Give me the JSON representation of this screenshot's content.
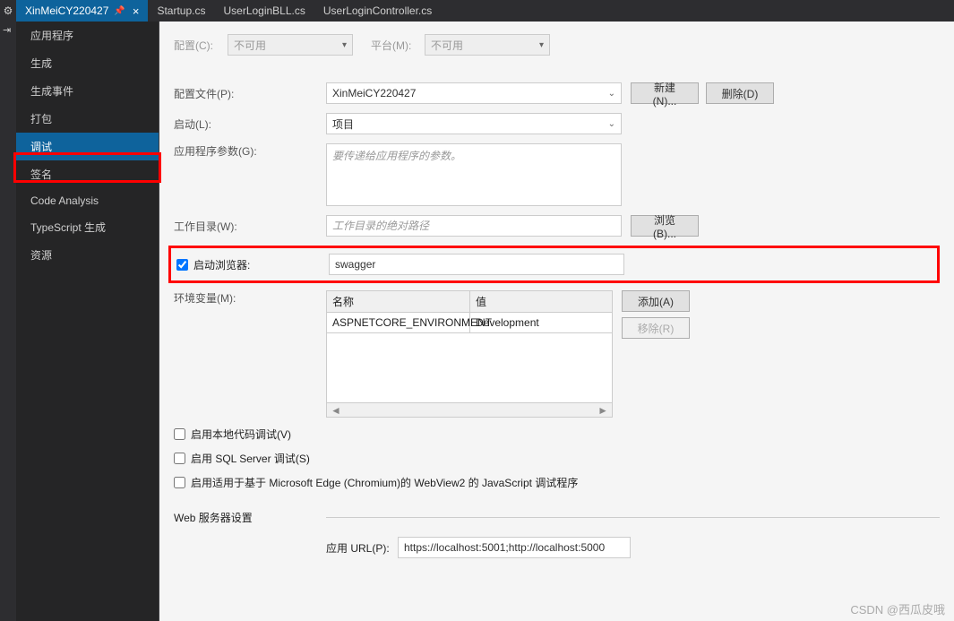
{
  "tabs": {
    "active": {
      "label": "XinMeiCY220427",
      "pinned": true
    },
    "others": [
      {
        "label": "Startup.cs"
      },
      {
        "label": "UserLoginBLL.cs"
      },
      {
        "label": "UserLoginController.cs"
      }
    ]
  },
  "sidebar": {
    "items": [
      {
        "label": "应用程序"
      },
      {
        "label": "生成"
      },
      {
        "label": "生成事件"
      },
      {
        "label": "打包"
      },
      {
        "label": "调试",
        "selected": true
      },
      {
        "label": "签名"
      },
      {
        "label": "Code Analysis"
      },
      {
        "label": "TypeScript 生成"
      },
      {
        "label": "资源"
      }
    ]
  },
  "topRow": {
    "configLabel": "配置(C):",
    "configValue": "不可用",
    "platformLabel": "平台(M):",
    "platformValue": "不可用"
  },
  "profile": {
    "label": "配置文件(P):",
    "value": "XinMeiCY220427",
    "newBtn": "新建(N)...",
    "deleteBtn": "删除(D)"
  },
  "launch": {
    "label": "启动(L):",
    "value": "项目"
  },
  "appArgs": {
    "label": "应用程序参数(G):",
    "placeholder": "要传递给应用程序的参数。"
  },
  "workDir": {
    "label": "工作目录(W):",
    "placeholder": "工作目录的绝对路径",
    "browseBtn": "浏览(B)..."
  },
  "launchBrowser": {
    "label": "启动浏览器:",
    "value": "swagger",
    "checked": true
  },
  "envVars": {
    "label": "环境变量(M):",
    "col1": "名称",
    "col2": "值",
    "rows": [
      {
        "name": "ASPNETCORE_ENVIRONMENT",
        "value": "Development"
      }
    ],
    "addBtn": "添加(A)",
    "removeBtn": "移除(R)"
  },
  "checks": {
    "nativeDebug": "启用本地代码调试(V)",
    "sqlDebug": "启用 SQL Server 调试(S)",
    "webview2": "启用适用于基于 Microsoft Edge (Chromium)的 WebView2 的 JavaScript 调试程序"
  },
  "webServer": {
    "heading": "Web 服务器设置",
    "appUrlLabel": "应用 URL(P):",
    "appUrlValue": "https://localhost:5001;http://localhost:5000"
  },
  "watermark": "CSDN @西瓜皮哦"
}
